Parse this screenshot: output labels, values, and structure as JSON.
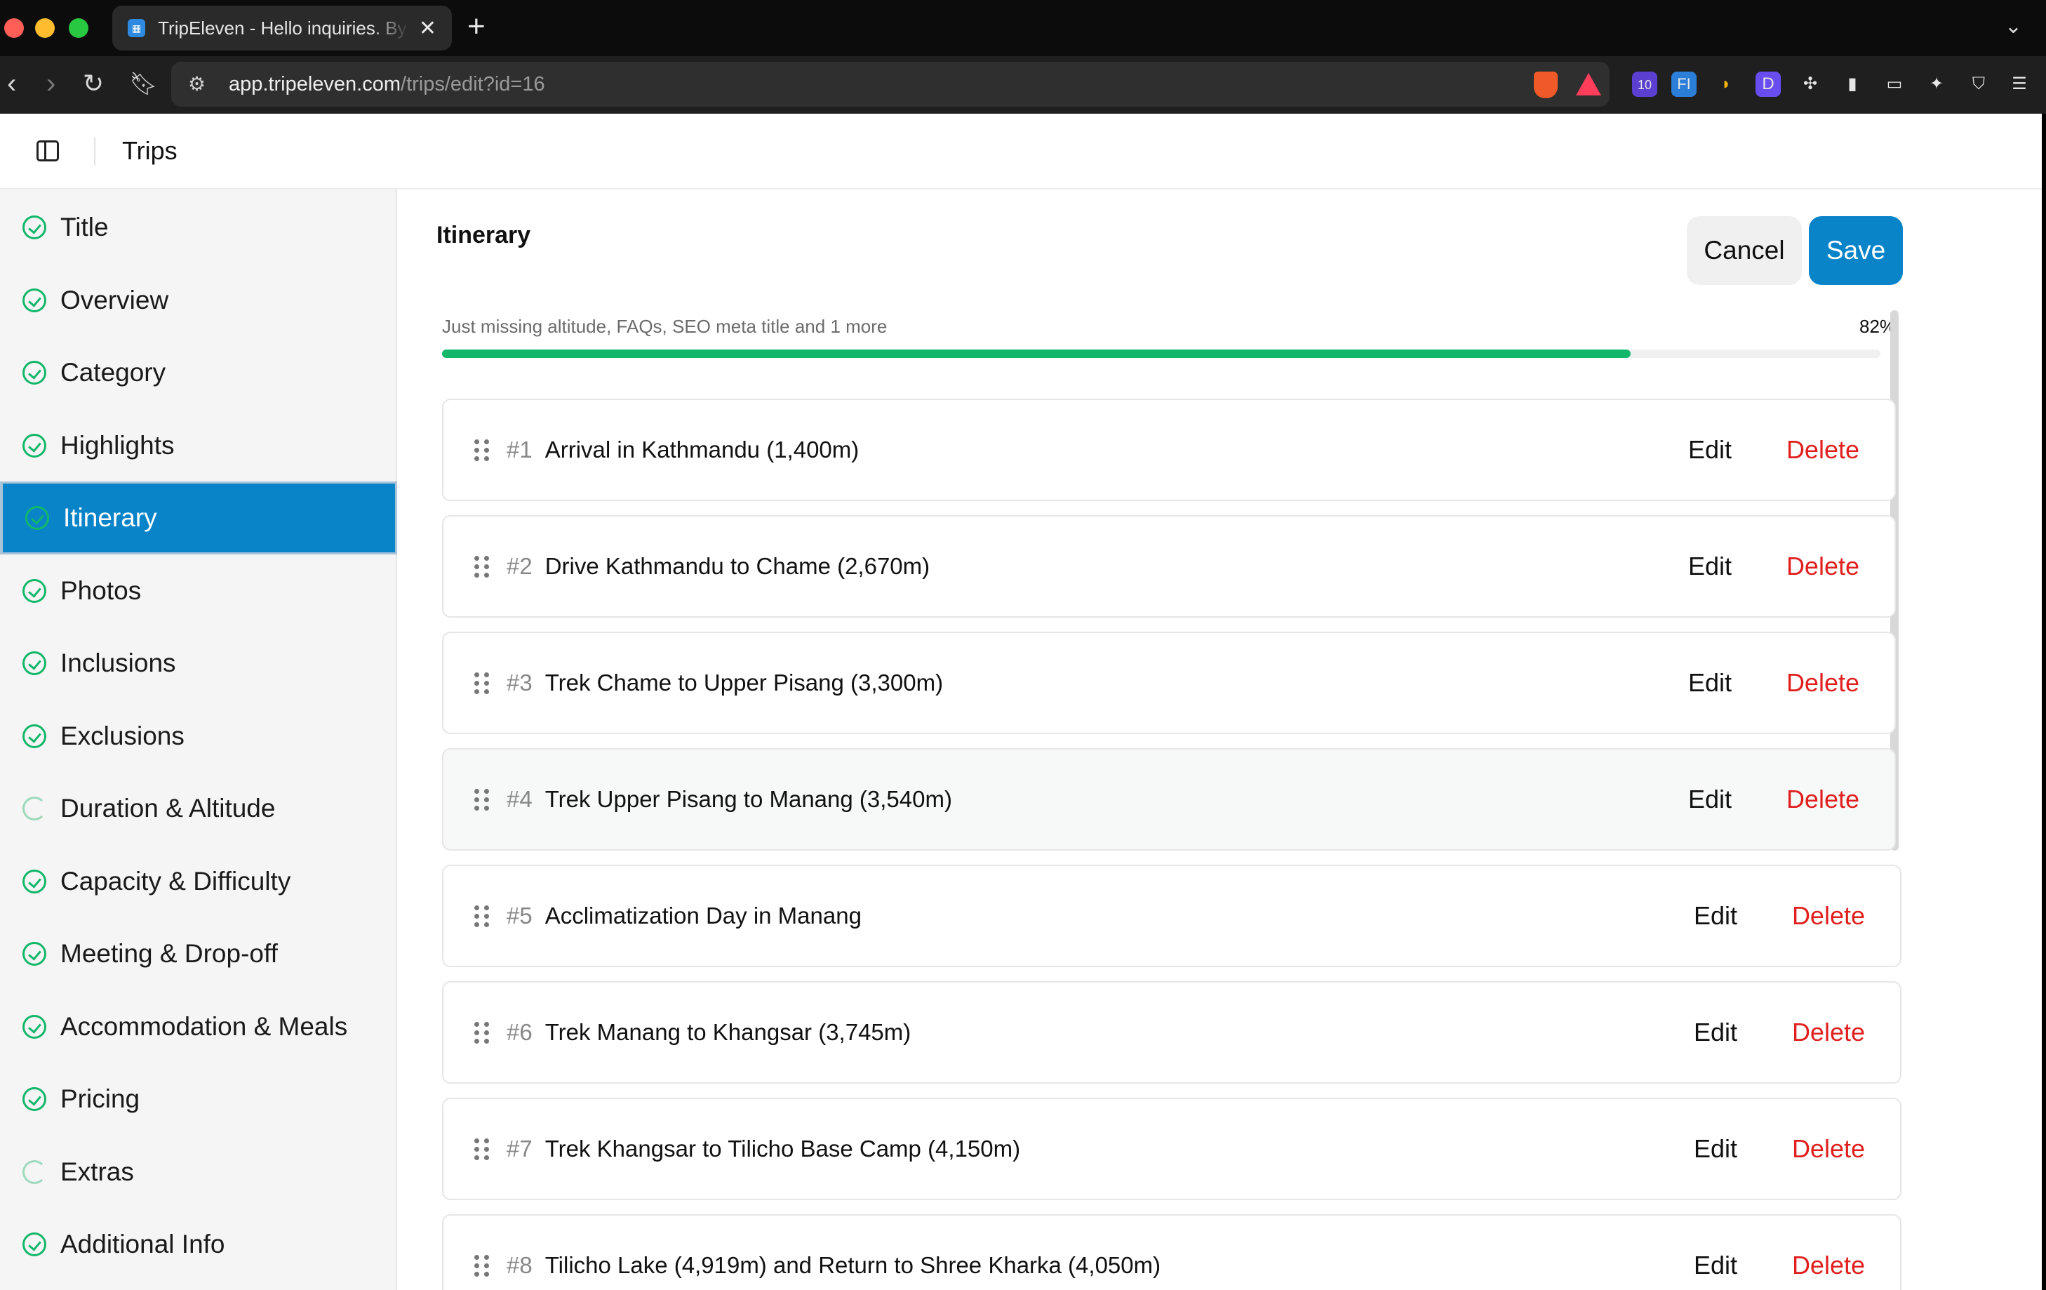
{
  "browser": {
    "tab_title": "TripEleven - Hello inquiries. By",
    "url_host": "app.tripeleven.com",
    "url_path": "/trips/edit?id=16",
    "extension_badge": "10",
    "extension_fi": "FI",
    "extension_d": "D"
  },
  "app": {
    "header_title": "Trips"
  },
  "sidebar": {
    "items": [
      {
        "label": "Title",
        "status": "done"
      },
      {
        "label": "Overview",
        "status": "done"
      },
      {
        "label": "Category",
        "status": "done"
      },
      {
        "label": "Highlights",
        "status": "done"
      },
      {
        "label": "Itinerary",
        "status": "done",
        "active": true
      },
      {
        "label": "Photos",
        "status": "done"
      },
      {
        "label": "Inclusions",
        "status": "done"
      },
      {
        "label": "Exclusions",
        "status": "done"
      },
      {
        "label": "Duration & Altitude",
        "status": "pending"
      },
      {
        "label": "Capacity & Difficulty",
        "status": "done"
      },
      {
        "label": "Meeting & Drop-off",
        "status": "done"
      },
      {
        "label": "Accommodation & Meals",
        "status": "done"
      },
      {
        "label": "Pricing",
        "status": "done"
      },
      {
        "label": "Extras",
        "status": "pending"
      },
      {
        "label": "Additional Info",
        "status": "done"
      }
    ]
  },
  "main": {
    "section_title": "Itinerary",
    "cancel_label": "Cancel",
    "save_label": "Save",
    "progress_text": "Just missing altitude, FAQs, SEO meta title and 1 more",
    "progress_label": "82%",
    "progress_value": 0.82,
    "edit_label": "Edit",
    "delete_label": "Delete",
    "itinerary": [
      {
        "num": "#1",
        "title": "Arrival in Kathmandu (1,400m)"
      },
      {
        "num": "#2",
        "title": "Drive Kathmandu to Chame (2,670m)"
      },
      {
        "num": "#3",
        "title": "Trek Chame to Upper Pisang (3,300m)"
      },
      {
        "num": "#4",
        "title": "Trek Upper Pisang to Manang (3,540m)"
      },
      {
        "num": "#5",
        "title": "Acclimatization Day in Manang"
      },
      {
        "num": "#6",
        "title": "Trek Manang to Khangsar (3,745m)"
      },
      {
        "num": "#7",
        "title": "Trek Khangsar to Tilicho Base Camp (4,150m)"
      },
      {
        "num": "#8",
        "title": "Tilicho Lake (4,919m) and Return to Shree Kharka (4,050m)"
      }
    ]
  },
  "colors": {
    "accent": "#0a84c9",
    "success": "#12b76a",
    "danger": "#e0201f"
  }
}
